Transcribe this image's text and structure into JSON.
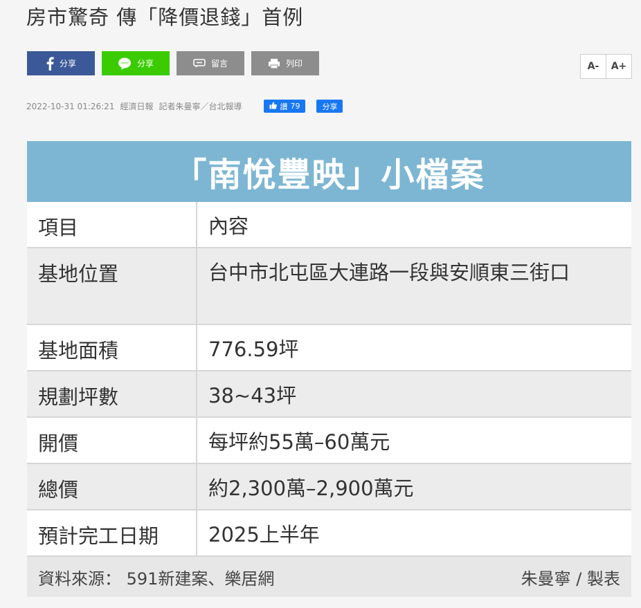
{
  "headline": "房市驚奇 傳「降價退錢」首例",
  "share": {
    "facebook": "分享",
    "line": "分享",
    "comment": "留言",
    "print": "列印"
  },
  "font_size": {
    "decrease": "A-",
    "increase": "A+"
  },
  "meta": {
    "datetime": "2022-10-31 01:26:21",
    "source": "經濟日報",
    "reporter": "記者朱曼寧／台北報導",
    "like_label": "讚",
    "like_count": "79",
    "share_label": "分享"
  },
  "card": {
    "title": "「南悅豐映」小檔案",
    "rows": [
      {
        "k": "項目",
        "v": "內容"
      },
      {
        "k": "基地位置",
        "v": "台中市北屯區大連路一段與安順東三街口"
      },
      {
        "k": "基地面積",
        "v": "776.59坪"
      },
      {
        "k": "規劃坪數",
        "v": "38~43坪"
      },
      {
        "k": "開價",
        "v": "每坪約55萬–60萬元"
      },
      {
        "k": "總價",
        "v": "約2,300萬–2,900萬元"
      },
      {
        "k": "預計完工日期",
        "v": "2025上半年"
      }
    ],
    "footer_left": "資料來源： 591新建案、樂居網",
    "footer_right": "朱曼寧 / 製表"
  },
  "colors": {
    "facebook": "#3b5998",
    "line": "#3acc00",
    "grey_button": "#8d8d8d",
    "card_title_bg": "#7db6d3",
    "like_pill": "#1877f2"
  }
}
